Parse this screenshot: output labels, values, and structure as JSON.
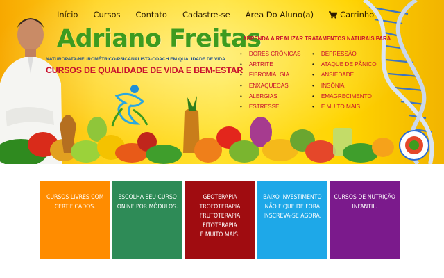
{
  "nav": {
    "items": [
      "Início",
      "Cursos",
      "Contato",
      "Cadastre-se",
      "Área Do Aluno(a)"
    ],
    "cart_label": "Carrinho",
    "cart_icon": "cart-icon"
  },
  "hero": {
    "brand": "Adriano Freitas",
    "subline": "NATUROPATA-NEUROMÉTRICO-PSICANALISTA-COACH EM QUALIDADE DE VIDA",
    "tagline": "CURSOS DE QUALIDADE DE VIDA E BEM-ESTAR",
    "learn_title": "APRENDA A REALIZAR TRATAMENTOS NATURAIS PARA",
    "ailments_col1": [
      "DORES CRÔNICAS",
      "ARTRITE",
      "FIBROMIALGIA",
      "ENXAQUECAS",
      "ALERGIAS",
      "ESTRESSE"
    ],
    "ailments_col2": [
      "DEPRESSÃO",
      "ATAQUE DE PÂNICO",
      "ANSIEDADE",
      "INSÔNIA",
      "EMAGRECIMENTO",
      "E MUITO MAIS..."
    ],
    "colors": {
      "brand": "#3d9b1f",
      "accent_red": "#c8102e",
      "banner_yellow": "#ffd21a",
      "navy": "#1c4d8c"
    }
  },
  "tiles": [
    {
      "lines": [
        "CURSOS LIVRES COM",
        "CERTIFICADOS."
      ],
      "color": "#ff8c00"
    },
    {
      "lines": [
        "ESCOLHA SEU CURSO",
        "ONINE POR MÓDULOS."
      ],
      "color": "#2e8b57"
    },
    {
      "lines": [
        "GEOTERAPIA",
        "TROFOTERAPIA",
        "FRUTOTERAPIA",
        "FITOTERAPIA",
        "E MUITO MAIS."
      ],
      "color": "#a00c10"
    },
    {
      "lines": [
        "BAIXO INVESTIMENTO",
        "NÃO FIQUE DE FORA",
        "INSCREVA-SE AGORA."
      ],
      "color": "#1ea8e8"
    },
    {
      "lines": [
        "CURSOS DE NUTRIÇÃO",
        "INFANTIL."
      ],
      "color": "#7b1a8c"
    }
  ]
}
